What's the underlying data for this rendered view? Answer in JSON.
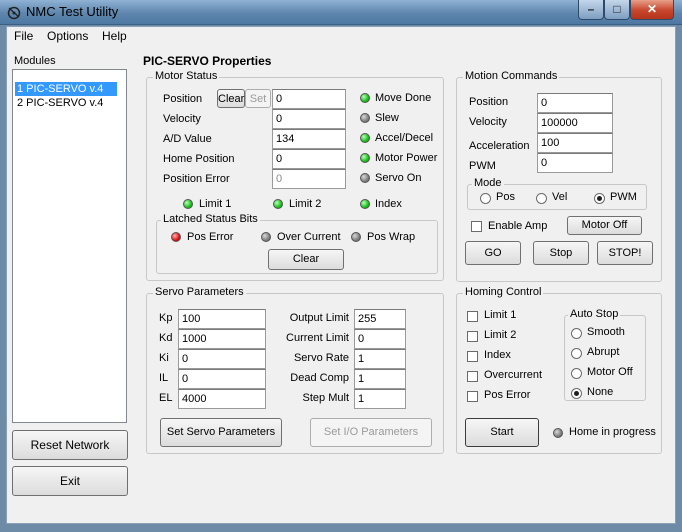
{
  "window": {
    "title": "NMC Test Utility",
    "minimize_glyph": "–",
    "maximize_glyph": "□",
    "close_glyph": "✕"
  },
  "menu": {
    "items": [
      "File",
      "Options",
      "Help"
    ]
  },
  "modules": {
    "label": "Modules",
    "items": [
      "1 PIC-SERVO v.4",
      "2 PIC-SERVO v.4"
    ],
    "selected_index": 0,
    "reset_button": "Reset Network",
    "exit_button": "Exit"
  },
  "properties": {
    "heading": "PIC-SERVO Properties",
    "motor_status": {
      "label": "Motor Status",
      "position_label": "Position",
      "clear_button": "Clear",
      "set_button": "Set",
      "position_value": "0",
      "velocity_label": "Velocity",
      "velocity_value": "0",
      "ad_label": "A/D Value",
      "ad_value": "134",
      "home_label": "Home Position",
      "home_value": "0",
      "poserr_label": "Position Error",
      "poserr_value": "0",
      "indicators": [
        {
          "label": "Move Done",
          "state": "green"
        },
        {
          "label": "Slew",
          "state": "gray"
        },
        {
          "label": "Accel/Decel",
          "state": "green"
        },
        {
          "label": "Motor Power",
          "state": "green"
        },
        {
          "label": "Servo On",
          "state": "gray"
        }
      ],
      "limit1_label": "Limit 1",
      "limit1_state": "green",
      "limit2_label": "Limit 2",
      "limit2_state": "green",
      "index_label": "Index",
      "index_state": "green",
      "latched": {
        "label": "Latched Status Bits",
        "pos_error_label": "Pos Error",
        "pos_error_state": "red",
        "over_current_label": "Over Current",
        "over_current_state": "gray",
        "pos_wrap_label": "Pos Wrap",
        "pos_wrap_state": "gray",
        "clear_button": "Clear"
      }
    },
    "motion_commands": {
      "label": "Motion Commands",
      "position_label": "Position",
      "position_value": "0",
      "velocity_label": "Velocity",
      "velocity_value": "100000",
      "accel_label": "Acceleration",
      "accel_value": "100",
      "pwm_label": "PWM",
      "pwm_value": "0",
      "mode_label": "Mode",
      "mode_options": [
        "Pos",
        "Vel",
        "PWM"
      ],
      "mode_selected": "PWM",
      "enable_amp_label": "Enable Amp",
      "enable_amp_checked": false,
      "motor_off_button": "Motor Off",
      "go_button": "GO",
      "stop_button": "Stop",
      "stop_bang_button": "STOP!"
    },
    "servo_parameters": {
      "label": "Servo Parameters",
      "kp_label": "Kp",
      "kp_value": "100",
      "kd_label": "Kd",
      "kd_value": "1000",
      "ki_label": "Ki",
      "ki_value": "0",
      "il_label": "IL",
      "il_value": "0",
      "el_label": "EL",
      "el_value": "4000",
      "output_limit_label": "Output Limit",
      "output_limit_value": "255",
      "current_limit_label": "Current Limit",
      "current_limit_value": "0",
      "servo_rate_label": "Servo Rate",
      "servo_rate_value": "1",
      "dead_comp_label": "Dead Comp",
      "dead_comp_value": "1",
      "step_mult_label": "Step Mult",
      "step_mult_value": "1",
      "set_servo_button": "Set Servo Parameters",
      "set_io_button": "Set I/O Parameters"
    },
    "homing_control": {
      "label": "Homing Control",
      "checks": [
        "Limit 1",
        "Limit 2",
        "Index",
        "Overcurrent",
        "Pos Error"
      ],
      "auto_stop_label": "Auto Stop",
      "auto_stop_options": [
        "Smooth",
        "Abrupt",
        "Motor Off",
        "None"
      ],
      "auto_stop_selected": "None",
      "start_button": "Start",
      "home_in_progress_label": "Home in progress",
      "home_in_progress_state": "gray"
    }
  }
}
